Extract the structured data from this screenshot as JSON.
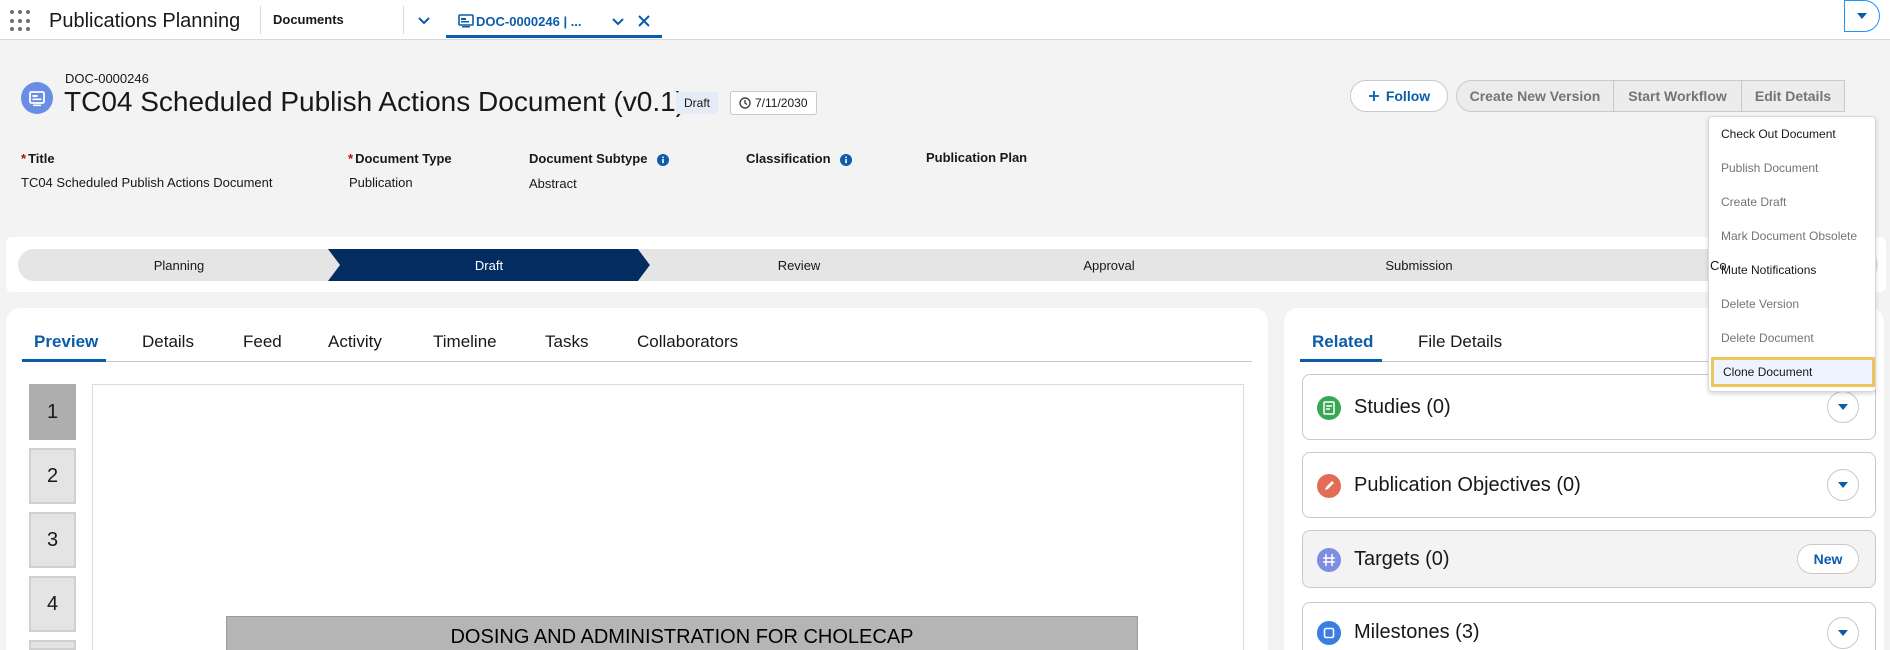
{
  "app": {
    "name": "Publications Planning"
  },
  "nav": {
    "object_label": "Documents",
    "record_tab_label": "DOC-0000246 | ..."
  },
  "record": {
    "id": "DOC-0000246",
    "title": "TC04 Scheduled Publish Actions Document (v0.1)",
    "status": "Draft",
    "date": "7/11/2030"
  },
  "actions": {
    "follow": "Follow",
    "create_new_version": "Create New Version",
    "start_workflow": "Start Workflow",
    "edit_details": "Edit Details"
  },
  "menu": {
    "items": [
      {
        "label": "Check Out Document",
        "state": "enabled"
      },
      {
        "label": "Publish Document",
        "state": "disabled"
      },
      {
        "label": "Create Draft",
        "state": "disabled"
      },
      {
        "label": "Mark Document Obsolete",
        "state": "disabled"
      },
      {
        "label": "Mute Notifications",
        "state": "enabled"
      },
      {
        "label": "Delete Version",
        "state": "disabled"
      },
      {
        "label": "Delete Document",
        "state": "disabled"
      },
      {
        "label": "Clone Document",
        "state": "focused"
      }
    ]
  },
  "fields": {
    "title_label": "Title",
    "title_value": "TC04 Scheduled Publish Actions Document",
    "doc_type_label": "Document Type",
    "doc_type_value": "Publication",
    "doc_subtype_label": "Document Subtype",
    "doc_subtype_value": "Abstract",
    "classification_label": "Classification",
    "publication_plan_label": "Publication Plan"
  },
  "path": {
    "steps": [
      "Planning",
      "Draft",
      "Review",
      "Approval",
      "Submission",
      "Co"
    ],
    "active": "Draft"
  },
  "tabs": [
    "Preview",
    "Details",
    "Feed",
    "Activity",
    "Timeline",
    "Tasks",
    "Collaborators"
  ],
  "preview": {
    "pages": [
      "1",
      "2",
      "3",
      "4"
    ],
    "heading": "DOSING AND ADMINISTRATION FOR CHOLECAP"
  },
  "related": {
    "tabs": [
      "Related",
      "File Details"
    ],
    "lists": [
      {
        "title": "Studies (0)",
        "icon": "study-icon",
        "color": "#3ba755"
      },
      {
        "title": "Publication Objectives (0)",
        "icon": "pencil-icon",
        "color": "#e26d57"
      },
      {
        "title": "Targets (0)",
        "icon": "target-icon",
        "color": "#7f8de1",
        "action": "New"
      },
      {
        "title": "Milestones (3)",
        "icon": "square-icon",
        "color": "#3b7de0"
      }
    ]
  },
  "colors": {
    "brand": "#0b5cab",
    "path_active": "#032d60",
    "focus_ring": "#ecc65a"
  }
}
